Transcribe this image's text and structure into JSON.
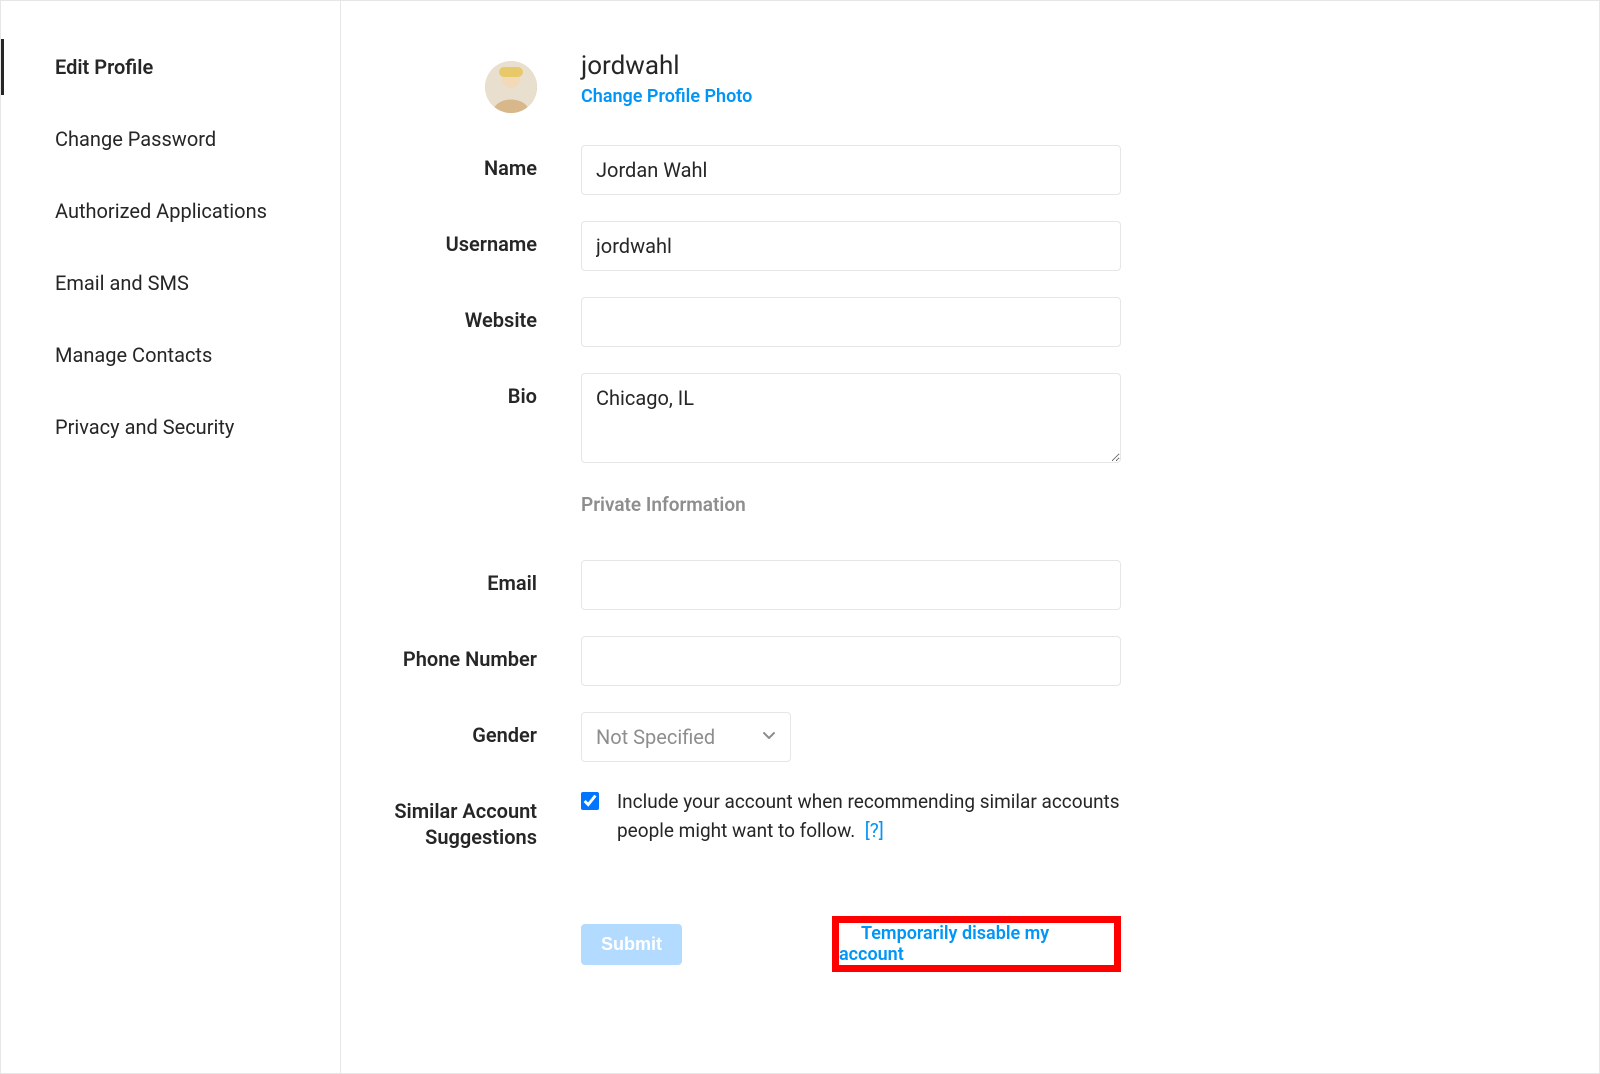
{
  "sidebar": {
    "items": [
      {
        "label": "Edit Profile",
        "active": true
      },
      {
        "label": "Change Password",
        "active": false
      },
      {
        "label": "Authorized Applications",
        "active": false
      },
      {
        "label": "Email and SMS",
        "active": false
      },
      {
        "label": "Manage Contacts",
        "active": false
      },
      {
        "label": "Privacy and Security",
        "active": false
      }
    ]
  },
  "profile": {
    "username_display": "jordwahl",
    "change_photo_label": "Change Profile Photo"
  },
  "labels": {
    "name": "Name",
    "username": "Username",
    "website": "Website",
    "bio": "Bio",
    "private_info_heading": "Private Information",
    "email": "Email",
    "phone": "Phone Number",
    "gender": "Gender",
    "similar_suggestions": "Similar Account Suggestions"
  },
  "fields": {
    "name": "Jordan Wahl",
    "username": "jordwahl",
    "website": "",
    "bio": "Chicago, IL",
    "email": "",
    "phone": "",
    "gender_selected": "Not Specified"
  },
  "similar": {
    "checked": true,
    "text": "Include your account when recommending similar accounts people might want to follow.",
    "help": "[?]"
  },
  "actions": {
    "submit_label": "Submit",
    "disable_label": "Temporarily disable my account"
  },
  "colors": {
    "link": "#0095f6",
    "highlight": "#ff0000"
  }
}
